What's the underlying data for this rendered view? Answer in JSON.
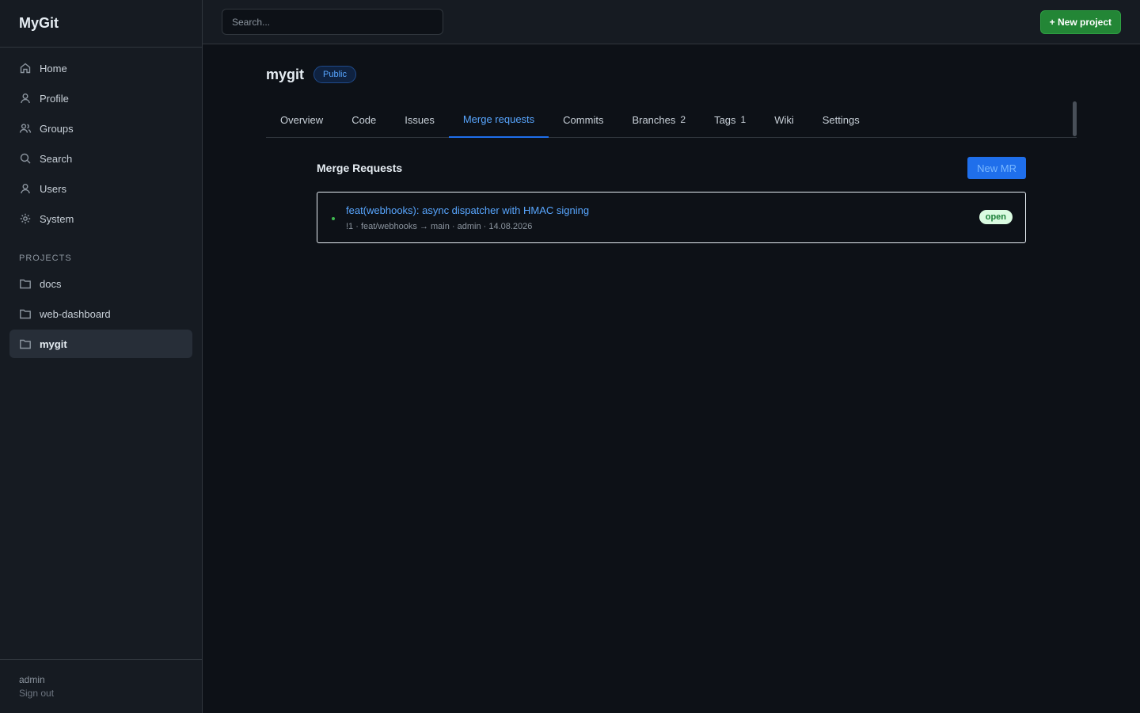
{
  "app": {
    "name": "MyGit"
  },
  "sidebar": {
    "items": [
      {
        "label": "Home",
        "icon": "home-icon"
      },
      {
        "label": "Profile",
        "icon": "user-icon"
      },
      {
        "label": "Groups",
        "icon": "users-icon"
      },
      {
        "label": "Search",
        "icon": "search-icon"
      },
      {
        "label": "Users",
        "icon": "user-icon"
      },
      {
        "label": "System",
        "icon": "gear-icon"
      }
    ],
    "projects_label": "PROJECTS",
    "projects": [
      {
        "label": "docs",
        "icon": "folder-icon"
      },
      {
        "label": "web-dashboard",
        "icon": "folder-icon"
      },
      {
        "label": "mygit",
        "icon": "folder-icon",
        "active": true
      }
    ],
    "footer": {
      "user": "admin",
      "signout": "Sign out"
    }
  },
  "topbar": {
    "search_placeholder": "Search...",
    "new_project_label": "+ New project"
  },
  "repo": {
    "name": "mygit",
    "visibility": "Public"
  },
  "tabs": [
    {
      "label": "Overview"
    },
    {
      "label": "Code"
    },
    {
      "label": "Issues"
    },
    {
      "label": "Merge requests",
      "active": true
    },
    {
      "label": "Commits"
    },
    {
      "label": "Branches",
      "count": "2"
    },
    {
      "label": "Tags",
      "count": "1"
    },
    {
      "label": "Wiki"
    },
    {
      "label": "Settings"
    }
  ],
  "merge_requests": {
    "title": "Merge Requests",
    "new_button": "New MR",
    "items": [
      {
        "title": "feat(webhooks): async dispatcher with HMAC signing",
        "meta": "!1 · feat/webhooks → main · admin · 14.08.2026",
        "status": "open"
      }
    ]
  },
  "colors": {
    "background": "#0d1117",
    "sidebar": "#161b22",
    "accent": "#58a6ff",
    "primary_button": "#238636",
    "blue_button": "#1f6feb",
    "status_open": "#3fb950"
  }
}
